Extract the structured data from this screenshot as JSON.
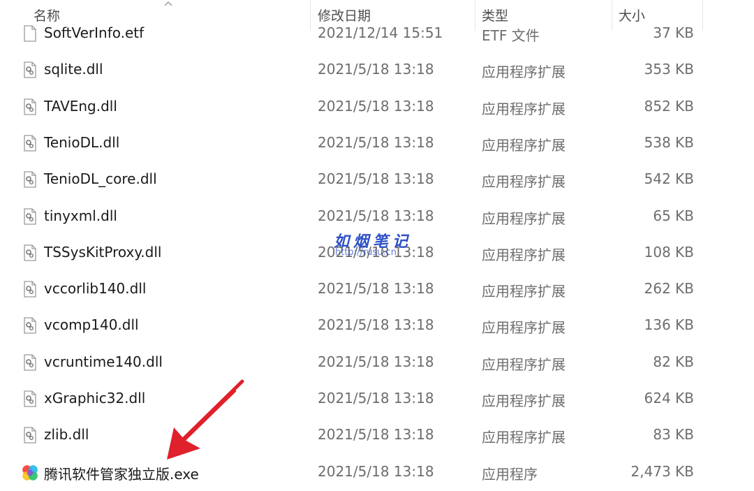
{
  "columns": {
    "name": "名称",
    "date": "修改日期",
    "type": "类型",
    "size": "大小"
  },
  "files": [
    {
      "name": "SoftVerInfo.etf",
      "date": "2021/12/14 15:51",
      "type": "ETF 文件",
      "size": "37 KB",
      "icon": "blank-file-icon"
    },
    {
      "name": "sqlite.dll",
      "date": "2021/5/18 13:18",
      "type": "应用程序扩展",
      "size": "353 KB",
      "icon": "dll-file-icon"
    },
    {
      "name": "TAVEng.dll",
      "date": "2021/5/18 13:18",
      "type": "应用程序扩展",
      "size": "852 KB",
      "icon": "dll-file-icon"
    },
    {
      "name": "TenioDL.dll",
      "date": "2021/5/18 13:18",
      "type": "应用程序扩展",
      "size": "538 KB",
      "icon": "dll-file-icon"
    },
    {
      "name": "TenioDL_core.dll",
      "date": "2021/5/18 13:18",
      "type": "应用程序扩展",
      "size": "542 KB",
      "icon": "dll-file-icon"
    },
    {
      "name": "tinyxml.dll",
      "date": "2021/5/18 13:18",
      "type": "应用程序扩展",
      "size": "65 KB",
      "icon": "dll-file-icon"
    },
    {
      "name": "TSSysKitProxy.dll",
      "date": "2021/5/18 13:18",
      "type": "应用程序扩展",
      "size": "108 KB",
      "icon": "dll-file-icon"
    },
    {
      "name": "vccorlib140.dll",
      "date": "2021/5/18 13:18",
      "type": "应用程序扩展",
      "size": "262 KB",
      "icon": "dll-file-icon"
    },
    {
      "name": "vcomp140.dll",
      "date": "2021/5/18 13:18",
      "type": "应用程序扩展",
      "size": "136 KB",
      "icon": "dll-file-icon"
    },
    {
      "name": "vcruntime140.dll",
      "date": "2021/5/18 13:18",
      "type": "应用程序扩展",
      "size": "82 KB",
      "icon": "dll-file-icon"
    },
    {
      "name": "xGraphic32.dll",
      "date": "2021/5/18 13:18",
      "type": "应用程序扩展",
      "size": "624 KB",
      "icon": "dll-file-icon"
    },
    {
      "name": "zlib.dll",
      "date": "2021/5/18 13:18",
      "type": "应用程序扩展",
      "size": "83 KB",
      "icon": "dll-file-icon"
    },
    {
      "name": "腾讯软件管家独立版.exe",
      "date": "2021/5/18 13:18",
      "type": "应用程序",
      "size": "2,473 KB",
      "icon": "tencent-app-icon"
    }
  ],
  "watermark": {
    "title": "如烟笔记",
    "url": "http://rusu.cn"
  },
  "colors": {
    "arrow": "#e0202a",
    "watermark": "#2c50c8"
  }
}
